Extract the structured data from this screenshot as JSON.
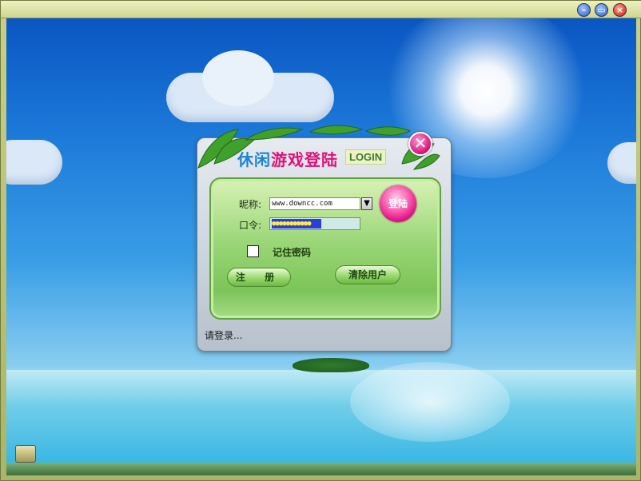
{
  "window": {
    "controls": {
      "minimize_icon": "circle-minus-icon",
      "restore_icon": "circle-restore-icon",
      "close_icon": "circle-x-icon"
    }
  },
  "dialog": {
    "title_part1": "休闲",
    "title_part2": "游戏登陆",
    "title_en": "LOGIN",
    "close_label": "✕",
    "nickname_label": "昵称:",
    "nickname_value": "www.downcc.com",
    "password_label": "口令:",
    "password_mask": "●●●●●●●●●●●",
    "login_button": "登陆",
    "remember_label": "记住密码",
    "register_button": "注 册",
    "clear_users_button": "清除用户",
    "status_text": "请登录..."
  },
  "colors": {
    "accent_pink": "#e0168a",
    "accent_blue": "#1a83d6",
    "panel_green": "#7cc458"
  }
}
